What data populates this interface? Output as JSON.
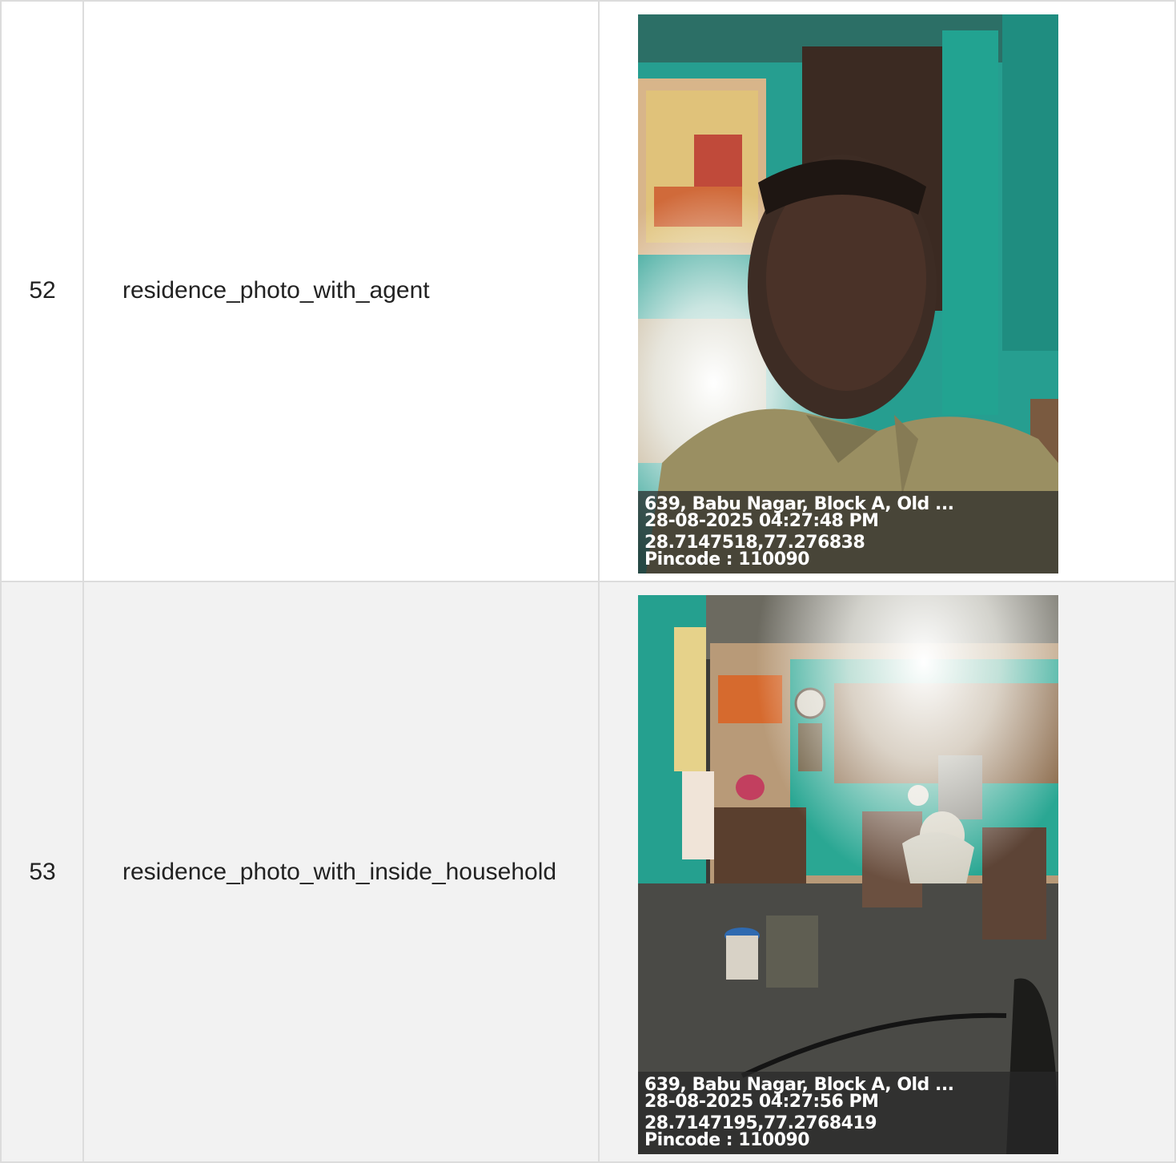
{
  "rows": [
    {
      "number": "52",
      "label": "residence_photo_with_agent",
      "photo": {
        "subject": "selfie-of-agent",
        "stamp": {
          "address": "639, Babu Nagar, Block A, Old ...",
          "datetime": "28-08-2025 04:27:48 PM",
          "coordinates": "28.7147518,77.276838",
          "pincode": "Pincode : 110090"
        }
      }
    },
    {
      "number": "53",
      "label": "residence_photo_with_inside_household",
      "photo": {
        "subject": "interior-of-shop-with-seated-man",
        "stamp": {
          "address": "639, Babu Nagar, Block A, Old ...",
          "datetime": "28-08-2025 04:27:56 PM",
          "coordinates": "28.7147195,77.2768419",
          "pincode": "Pincode : 110090"
        }
      }
    }
  ],
  "colors": {
    "row_alt_background": "#f2f2f2",
    "border": "#dcdcdc",
    "wall_teal": "#2fb5a3"
  }
}
